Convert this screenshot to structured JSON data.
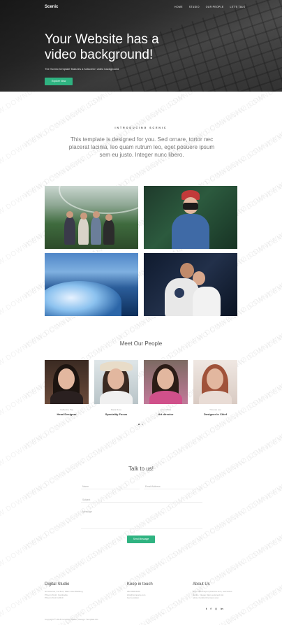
{
  "nav": {
    "brand": "Scenic",
    "links": [
      "Home",
      "Studio",
      "Our People",
      "Let's Talk"
    ]
  },
  "hero": {
    "title": "Your Website has a video background!",
    "subtitle": "The Scenic template features a fullscreen video background.",
    "button": "Explore Now"
  },
  "intro": {
    "eyebrow": "INTRODUCING SCENIC",
    "text": "This template is designed for you. Sed ornare, tortor nec placerat lacinia, leo quam rutrum leo, eget posuere ipsum sem eu justo. Integer nunc libero."
  },
  "gallery": [
    "greenhouse-group-photo",
    "photographer-red-cap",
    "ocean-wave",
    "couple-hug"
  ],
  "team": {
    "title": "Meet Our People",
    "members": [
      {
        "name": "Catherine Pay",
        "role": "Head Designer"
      },
      {
        "name": "Maria Rose",
        "role": "Speciality Focus"
      },
      {
        "name": "Anna White",
        "role": "Art director"
      },
      {
        "name": "Thomas Lee",
        "role": "Designer In Chief"
      }
    ]
  },
  "contact": {
    "title": "Talk to us!",
    "name_label": "Name",
    "email_label": "Email Address",
    "subject_label": "Subject",
    "message_label": "Message",
    "send_button": "Send Message"
  },
  "footer": {
    "col1_title": "Digital Studio",
    "col1_lines": [
      "3rd Avenue, 1st floor, Main Lane Building",
      "Phnom Penh, Cambodia",
      "Phnom Penh 12210"
    ],
    "col2_title": "Keep in touch",
    "col2_lines": [
      "050-098-0020",
      "info@company.com",
      "Get Location"
    ],
    "col3_title": "About Us",
    "col3_lines": [
      "Nam ullamcorper pharetra sem, sed lectus",
      "iaculis. Integer diam euismod nisi",
      "tellus, hendrerit tempor erat."
    ],
    "social": [
      "twitter-icon",
      "facebook-icon",
      "instagram-icon",
      "linkedin-icon"
    ],
    "copyright": "Copyright © 2018 Company Name | Design: Template Mo"
  },
  "colors": {
    "accent": "#2fb381"
  },
  "watermark": "WWW.DOWNDEMO.COM"
}
